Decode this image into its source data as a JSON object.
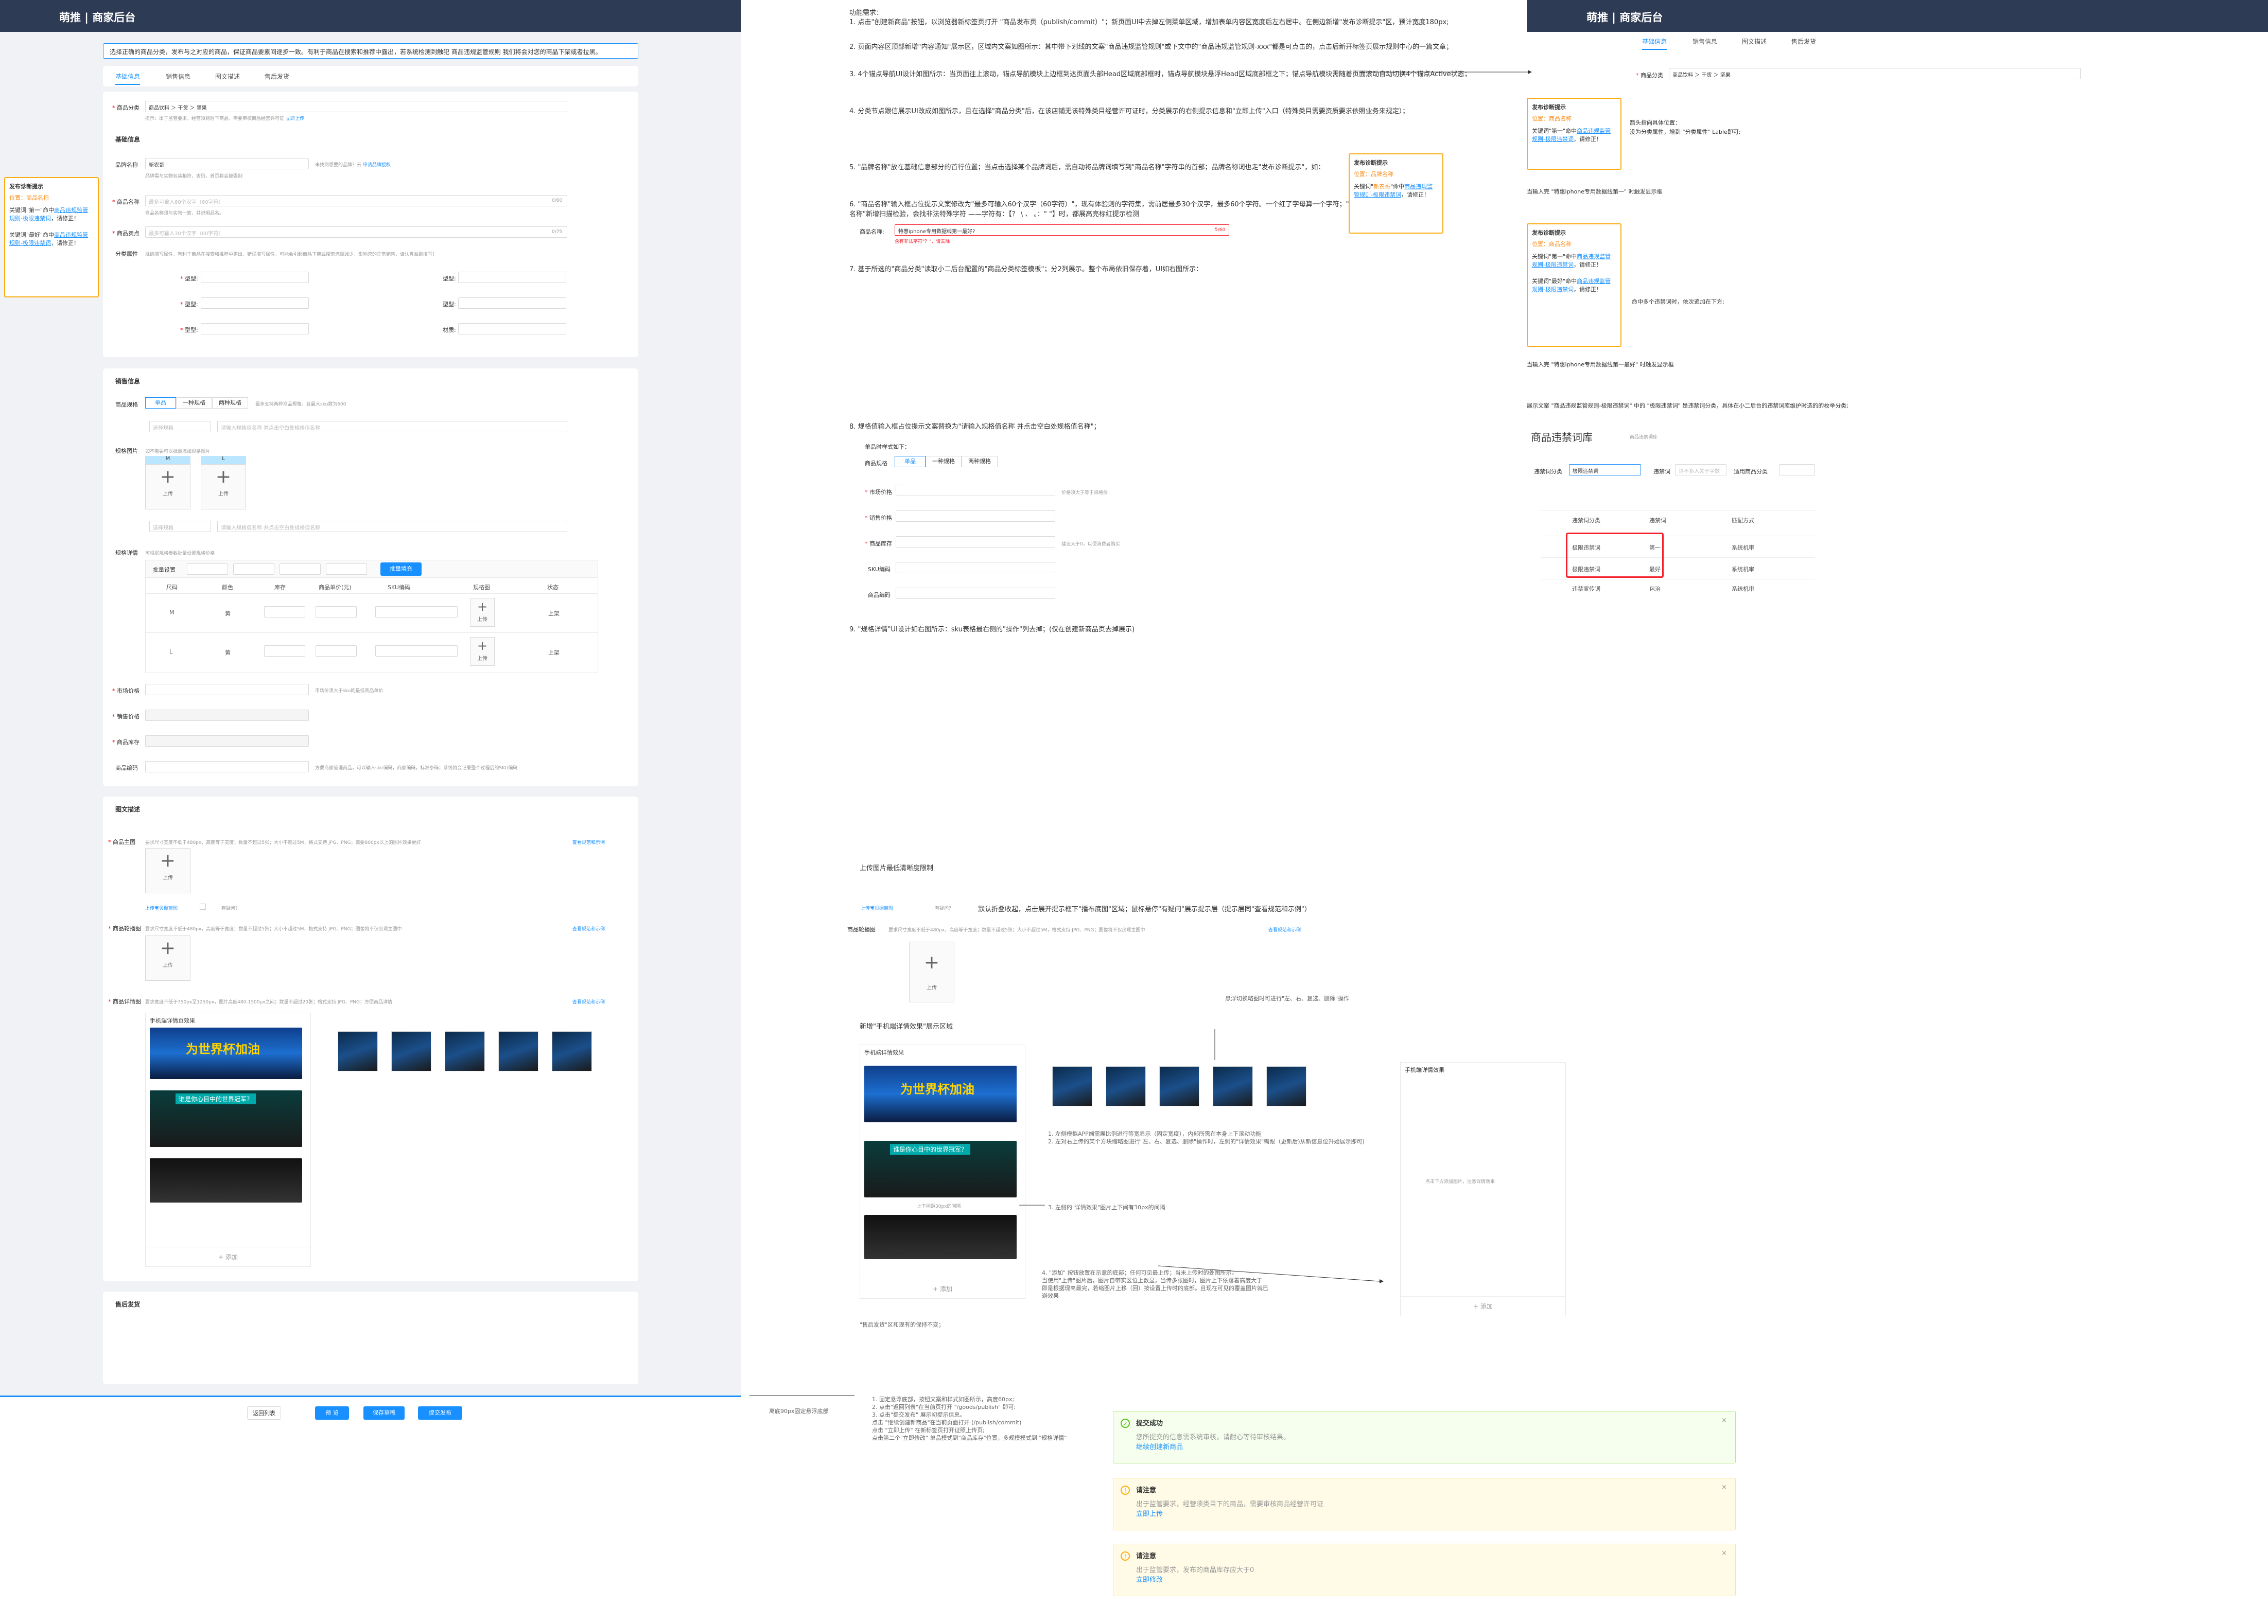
{
  "header": {
    "title": "萌推 | 商家后台"
  },
  "notice": "选择正确的商品分类，发布与之对应的商品，保证商品要素间逐步一致。有利于商品在搜索和推荐中露出，若系统检测到触犯 商品违规监管规则 我们将会对您的商品下架或者拉黑。",
  "tabs": [
    "基础信息",
    "销售信息",
    "图文描述",
    "售后发货"
  ],
  "category": {
    "label": "商品分类",
    "value": "商品饮料 ＞ 干货 ＞ 坚果",
    "hint": "提示：出于监管要求，经营须将后下商品，需要审核商品经营许可证",
    "hint_link": "立即上传"
  },
  "basic": {
    "title": "基础信息",
    "brand": {
      "label": "品牌名称",
      "value": "新农哥",
      "hint": "未找到想要的品牌？去",
      "hint_link": "申请品牌授权",
      "sub": "品牌需与实物包装相符，否则，首页将会被强制"
    },
    "name": {
      "label": "商品名称",
      "placeholder": "最多可输入60个汉字（60字符）",
      "count": "0/60",
      "sub": "商品名称须与实物一致，并说明品名。"
    },
    "selling": {
      "label": "商品卖点",
      "placeholder": "最多可输入30个汉字（60字符）",
      "count": "0/75"
    },
    "attr": {
      "label": "分类属性",
      "hint": "准确填写属性，有利于商品在搜索和推荐中露出，错误填写属性，可能会引起商品下架或搜索流量减少，影响您的正常销售，请认真准确填写！"
    },
    "attr_rows": [
      [
        "型型:",
        "型型:"
      ],
      [
        "型型:",
        "型型:"
      ],
      [
        "型型:",
        "材质:"
      ]
    ]
  },
  "sales": {
    "title": "销售信息",
    "spec_label": "商品规格",
    "segs": [
      "单品",
      "一种规格",
      "两种规格"
    ],
    "spec_hint": "最多支持两种商品规格，且最大sku数为600",
    "sel_placeholder": "选择规格",
    "input_placeholder": "请输入规格值名称 并点击空白处规格值名称",
    "img_label": "规格图片",
    "img_hint": "如不需要可以批量添加规格图片",
    "sizes": [
      "M",
      "L"
    ],
    "upload": "上传",
    "detail_label": "规格详情",
    "detail_hint": "可根据规格参数批量设置规格价格",
    "batch": "批量设置",
    "batch_btn": "批量填充",
    "cols": [
      "尺码",
      "颜色",
      "库存",
      "商品单价(元)",
      "SKU编码",
      "规格图",
      "状态"
    ],
    "rows": [
      [
        "M",
        "黄",
        "上架"
      ],
      [
        "L",
        "黄",
        "上架"
      ]
    ],
    "price_label": "市场价格",
    "price_hint": "市场价须大于sku的最低商品单价",
    "sale_label": "销售价格",
    "stock_label": "商品库存",
    "code_label": "商品编码",
    "code_hint": "方便商家管理商品，可以输入sku编码，商家编码，标准条码；系统将会记录整个过程后的SKU编码"
  },
  "desc": {
    "title": "图文描述",
    "main_label": "商品主图",
    "main_hint": "要求尺寸宽度不低于480px，高度等于宽度；数量不超过5张；大小不超过5M，格式支持 JPG、PNG；需要800px以上的图片效果更好",
    "example": "查看规范和示例",
    "video_link": "上传宝贝橱窗图",
    "video_hint": "有疑问？",
    "wide_label": "商品轮播图",
    "wide_hint": "要求尺寸宽度不低于480px，高度等于宽度；数量不超过5张；大小不超过5M，格式支持 JPG、PNG；图像将不仅出现主图中",
    "detail_label": "商品详情图",
    "detail_hint": "要求宽度不低于750px至1250px，图片高度480-1500px之间；数量不超过20张；格式支持 JPG、PNG；方便商品详情",
    "phone_title": "手机端详情页效果",
    "img1": "为世界杯加油",
    "img2": "谁是你心目中的世界冠军？",
    "add": "+ 添加"
  },
  "after": {
    "title": "售后发货"
  },
  "footer": {
    "back": "返回列表",
    "preview": "预 览",
    "save": "保存草稿",
    "submit": "提交发布"
  },
  "warn1": {
    "title": "发布诊断提示",
    "pos": "位置：商品名称",
    "p1a": "关键词\"第一\"命中",
    "p1b": "商品违规监管规则-极限违禁词",
    "p1c": "，请修正！",
    "p2a": "关键词\"最好\"命中",
    "p2b": "商品违规监管规则-极限违禁词",
    "p2c": "，请修正！"
  },
  "spec_doc": {
    "title": "功能需求：",
    "lines": [
      "1. 点击\"创建新商品\"按钮，以浏览器新标签页打开 \"商品发布页（publish/commit）\"；新页面UI中去掉左侧菜单区域，增加表单内容区宽度后左右居中。在侧边新增\"发布诊断提示\"区，预计宽度180px;",
      "2. 页面内容区顶部新增\"内容通知\"展示区，区域内文案如图所示：其中带下划线的文案\"商品违规监管规则\"或下文中的\"商品违规监管规则-xxx\"都是可点击的，点击后新开标签页展示规则中心的一篇文章；",
      "3. 4个锚点导航UI设计如图所示：当页面往上滚动，锚点导航模块上边框到达页面头部Head区域底部框时，锚点导航模块悬浮Head区域底部框之下；锚点导航模块需随着页面滚动自动切换4个锚点Active状态；",
      "4. 分类节点跟信展示UI改成如图所示，且在选择\"商品分类\"后，在该店铺无该特殊类目经营许可证时，分类展示的右侧提示信息和\"立即上传\"入口（特殊类目需要资质要求依照业务来规定）；",
      "5. \"品牌名称\"放在基础信息部分的首行位置；当点击选择某个品牌词后，需自动将品牌词填写到\"商品名称\"字符串的首部；品牌名称词也走\"发布诊断提示\"，如：",
      "6. \"商品名称\"输入框占位提示文案修改为\"最多可输入60个汉字（60字符）\"，现有体验则的字符集，需前居最多30个汉字，最多60个字符。一个红了字母算一个字符；\"商品名称\"新增扫描检验，会找非法特殊字符 ——字符有：【？ \\ 、 。：\" \"】时，都展高亮标红提示检测",
      "7. 基于所选的\"商品分类\"读取小二后台配置的\"商品分类标签模板\"；分2列展示。整个布局依旧保存着，UI如右图所示：",
      "8. 规格值输入框占位提示文案替换为\"请输入规格值名称 并点击空白处规格值名称\"；",
      "9. \"规格详情\"UI设计如右图所示：sku表格最右侧的\"操作\"列去掉；(仅在创建新商品页去掉展示)"
    ],
    "name_demo_label": "商品名称:",
    "name_demo_value": "特惠iphone专用数据线第一最好?",
    "name_demo_count": "5/60",
    "name_demo_err": "含有非法字符\"？\"，请去除",
    "single_title": "单品时样式如下：",
    "single_rows": [
      [
        "市场价格",
        "价格须大于等于规格价"
      ],
      [
        "销售价格",
        ""
      ],
      [
        "商品库存",
        "建议大于0，以便消费者购买"
      ],
      [
        "SKU编码",
        ""
      ],
      [
        "商品编码",
        ""
      ]
    ],
    "upload_title": "上传图片最低清晰度限制",
    "upload_link": "上传宝贝橱窗图",
    "upload_q": "有疑问？",
    "upload_note": "默认折叠收起，点击展开提示框下\"播布底图\"区域；鼠标悬停\"有疑问\"展示提示层（提示层同\"查看规范和示例\"）",
    "new_area": "新增\"手机端详情效果\"展示区域",
    "phone_title": "手机端详情效果",
    "img_note_right": "悬浮切换略图时可进行\"左、右、复选、删除\"操作",
    "feature_lines": [
      "1. 左侧模拟APP端需展比例进行等宽显示（固定宽度），内部所需在本身上下滚动功能",
      "2. 左对右上传的某个方块缩略图进行\"左、右、复选、删除\"操作时，左侧的\"详情效果\"需跟（更新后)从新信息位升始展示即可)"
    ],
    "gap_note": "上下间距30px的间隔",
    "gap_note2": "3. 左侧的\"详情效果\"图片上下间有30px的间隔",
    "add_note": [
      "4. \"添加\" 按钮放置在示意的底部；任何可见最上传；当未上传时的处图所示。",
      "当使用\"上传\"图片后，图片自带实区位上数显，当传多张图时，图片上下依落着高度大于",
      "即是根据现高最完，若缩图片上移（回）按设置上传时的底部。且现在可见的覆盖图片就已",
      "避效果"
    ],
    "empty_hint": "点击下方添加图片，注意详情效果",
    "after_note": "\"售后发货\"区和现有的保持不变；",
    "bottom_left": "离底90px固定悬浮底部",
    "bottom_lines": [
      "1. 固定悬浮底部，按钮文案和样式如图所示，高度60px;",
      "2. 点击\"返回列表\"在当前页打开 \"/goods/publish\" 即可;",
      "3. 点击\"提交发布\" 展示初提示信息。",
      "",
      "点击 \"继续创建新商品\"在当前页面打开 (/publish/commit)",
      "点击 \"立即上传\" 在新标签页打开证照上传页;",
      "",
      "点击第二个\"立即修改\" 单品模式到\"商品库存\"位置，多规模模式到 \"规格详情\""
    ]
  },
  "right_panel": {
    "hint1": "箭头指向具体位置：",
    "hint2": "没为分类属性，增到 \"分类属性\" Lable即可;",
    "hint3": "当输入完 \"特惠iphone专用数据线第一\" 时触发显示框",
    "hint4": "命中多个违禁词时，依次追加在下方;",
    "hint5": "当输入完 \"特惠iphone专用数据线第一最好\" 时触发显示框",
    "hint6": "展示文案 \"商品违规监管规则-极限违禁词\" 中的 \"极限违禁词\" 是违禁词分类，具体在小二后台的违禁词库维护时选的的枚举分类;",
    "lib_title": "商品违禁词库",
    "crumb": "商品违禁词库",
    "filter_labels": [
      "违禁词分类",
      "违禁词",
      "适用商品分类"
    ],
    "filter_value": "极限违禁词",
    "filter_ph": "请不多入关于字数",
    "lib_cols": [
      "违禁词分类",
      "违禁词",
      "匹配方式"
    ],
    "lib_rows": [
      [
        "极限违禁词",
        "第一",
        "系统机审"
      ],
      [
        "极限违禁词",
        "最好",
        "系统机审"
      ],
      [
        "违禁宣传词",
        "包治",
        "系统机审"
      ]
    ],
    "warn_a": {
      "title": "发布诊断提示",
      "pos": "位置：商品名称",
      "p1a": "关键词\"第一\"命中",
      "p1b": "商品违规监管规则-极限违禁词",
      "p1c": "，请修正！"
    },
    "warn_b": {
      "title": "发布诊断提示",
      "pos": "位置：商品名称",
      "p1a": "关键词\"第一\"命中",
      "p1b": "商品违规监管规则-极限违禁词",
      "p1c": "，请修正！",
      "p2a": "关键词\"最好\"命中",
      "p2b": "商品违规监管规则-极限违禁词",
      "p2c": "，请修正！"
    }
  },
  "alerts": [
    {
      "title": "提交成功",
      "body": "您所提交的信息需系统审核，请耐心等待审核结果。",
      "link": "继续创建新商品",
      "type": "success"
    },
    {
      "title": "请注意",
      "body": "出于监管要求，经营须类目下的商品，需要审核商品经营许可证",
      "link": "立即上传",
      "type": "warn"
    },
    {
      "title": "请注意",
      "body": "出于监管要求，发布的商品库存应大于0",
      "link": "立即修改",
      "type": "warn"
    }
  ],
  "colors": {
    "header": "#2e3b55",
    "primary": "#1890ff",
    "warn": "#faad14",
    "error": "#f5222d",
    "success": "#52c41a"
  }
}
